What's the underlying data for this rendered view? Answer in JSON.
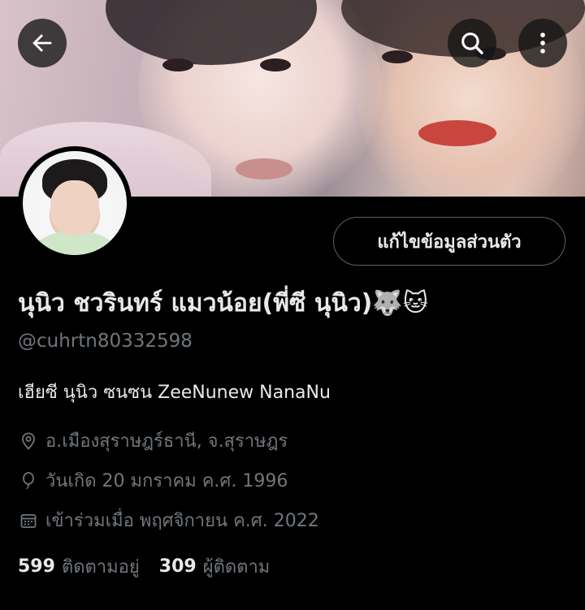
{
  "header": {
    "back_icon": "arrow-left-icon",
    "search_icon": "search-icon",
    "more_icon": "more-vertical-icon"
  },
  "profile": {
    "edit_button_label": "แก้ไขข้อมูลส่วนตัว",
    "display_name": "นุนิว ชวรินทร์ แมวน้อย(พี่ซี นุนิว)🐺🐱",
    "handle": "@cuhrtn80332598",
    "bio": "เฮียซี นุนิว ซนซน ZeeNunew NanaNu",
    "location": "อ.เมืองสุราษฎร์ธานี, จ.สุราษฎร",
    "birthday": "วันเกิด 20 มกราคม ค.ศ. 1996",
    "joined": "เข้าร่วมเมื่อ พฤศจิกายน ค.ศ. 2022"
  },
  "stats": {
    "following_count": "599",
    "following_label": "ติดตามอยู่",
    "followers_count": "309",
    "followers_label": "ผู้ติดตาม"
  },
  "colors": {
    "background": "#000000",
    "primary_text": "#e7e9ea",
    "secondary_text": "#71767b",
    "button_border": "#536471"
  }
}
